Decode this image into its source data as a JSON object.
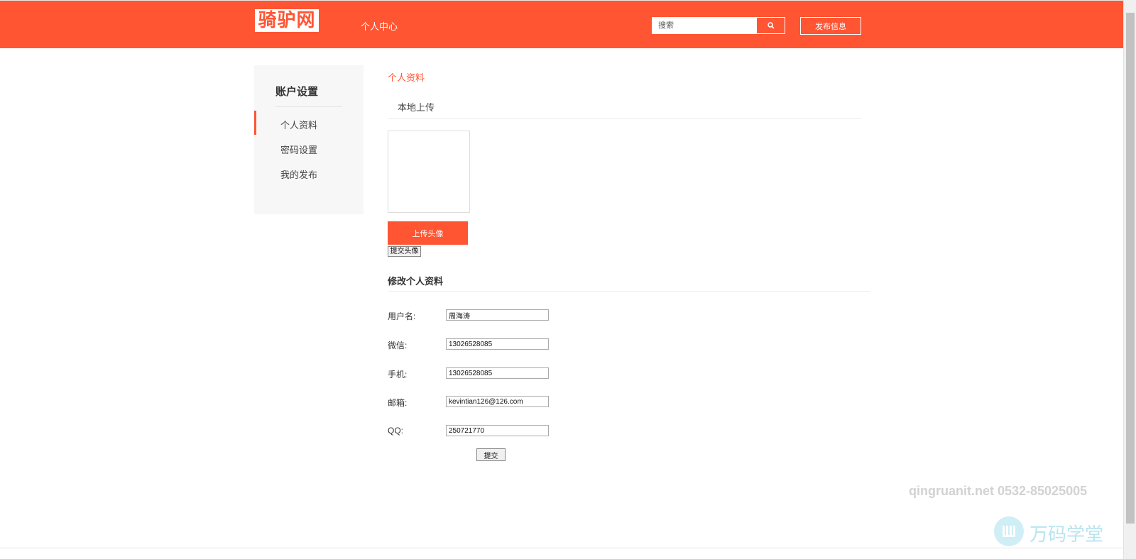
{
  "header": {
    "logo_text": "骑驴网",
    "nav_link": "个人中心",
    "search_placeholder": "搜索",
    "publish_label": "发布信息"
  },
  "colors": {
    "brand": "#FF5533",
    "sidebar_bg": "#F7F7F7"
  },
  "sidebar": {
    "title": "账户设置",
    "items": [
      {
        "label": "个人资料",
        "active": true
      },
      {
        "label": "密码设置",
        "active": false
      },
      {
        "label": "我的发布",
        "active": false
      }
    ]
  },
  "main": {
    "breadcrumb": "个人资料",
    "upload_tab": "本地上传",
    "upload_button": "上传头像",
    "submit_avatar_button": "提交头像",
    "section_title": "修改个人资料",
    "fields": [
      {
        "label": "用户名:",
        "value": "周海涛"
      },
      {
        "label": "微信:",
        "value": "13026528085"
      },
      {
        "label": "手机:",
        "value": "13026528085"
      },
      {
        "label": "邮箱:",
        "value": "kevintian126@126.com"
      },
      {
        "label": "QQ:",
        "value": "250721770"
      }
    ],
    "submit_button": "提交"
  },
  "watermark": {
    "contact": "qingruanit.net 0532-85025005",
    "brand": "万码学堂"
  },
  "icons": {
    "search": "search-icon",
    "watermark_logo": "brand-logo-icon"
  }
}
